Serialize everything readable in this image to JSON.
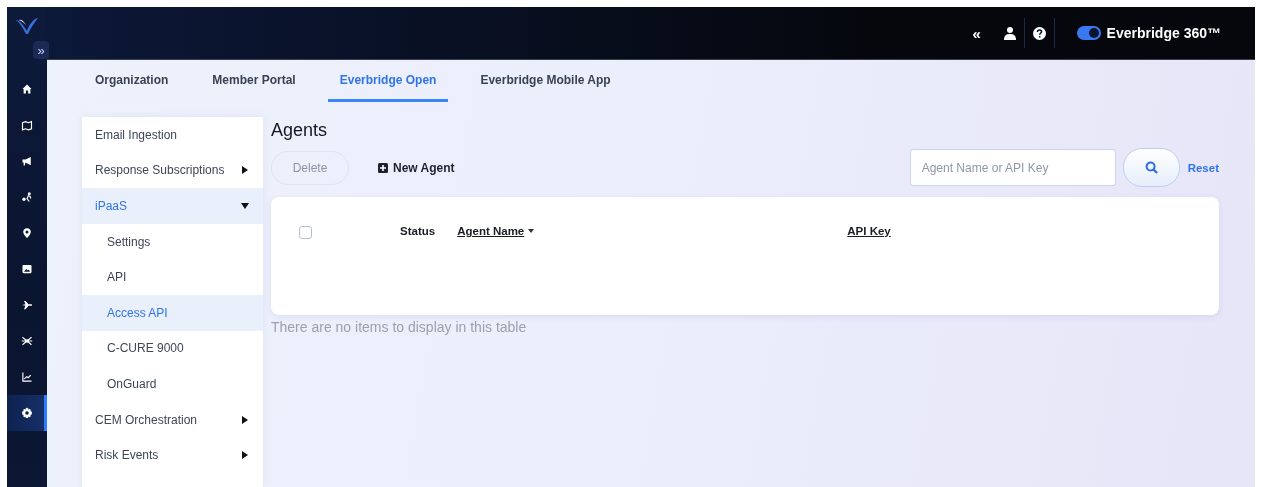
{
  "rail": {
    "expand_label": "»",
    "items": [
      {
        "kind": "home",
        "selected": false
      },
      {
        "kind": "map",
        "selected": false
      },
      {
        "kind": "megaphone",
        "selected": false
      },
      {
        "kind": "people",
        "selected": false
      },
      {
        "kind": "pin",
        "selected": false
      },
      {
        "kind": "image",
        "selected": false
      },
      {
        "kind": "plane",
        "selected": false
      },
      {
        "kind": "network",
        "selected": false
      },
      {
        "kind": "chart",
        "selected": false
      },
      {
        "kind": "gear",
        "selected": true
      }
    ]
  },
  "top_bar": {
    "collapse_label": "«",
    "toggle_on": true,
    "product": "Everbridge 360™"
  },
  "tabs": [
    {
      "label": "Organization",
      "selected": false
    },
    {
      "label": "Member Portal",
      "selected": false
    },
    {
      "label": "Everbridge Open",
      "selected": true
    },
    {
      "label": "Everbridge Mobile App",
      "selected": false
    }
  ],
  "submenu": [
    {
      "label": "Email Ingestion",
      "kind": "link",
      "selected": false
    },
    {
      "label": "Response Subscriptions",
      "kind": "group",
      "expanded": false,
      "selected": false
    },
    {
      "label": "iPaaS",
      "kind": "group",
      "expanded": true,
      "selected": true,
      "children": [
        {
          "label": "Settings",
          "selected": false
        },
        {
          "label": "API",
          "selected": false
        },
        {
          "label": "Access API",
          "selected": true
        },
        {
          "label": "C-CURE 9000",
          "selected": false
        },
        {
          "label": "OnGuard",
          "selected": false
        }
      ]
    },
    {
      "label": "CEM Orchestration",
      "kind": "group",
      "expanded": false,
      "selected": false
    },
    {
      "label": "Risk Events",
      "kind": "group",
      "expanded": false,
      "selected": false
    }
  ],
  "page": {
    "title": "Agents",
    "delete_label": "Delete",
    "delete_disabled": true,
    "new_label": "New Agent",
    "search": {
      "placeholder": "Agent Name or API Key"
    },
    "reset_label": "Reset"
  },
  "table": {
    "select_all_checked": false,
    "columns": [
      {
        "label": "Status",
        "sortable": false,
        "sorted": false
      },
      {
        "label": "Agent Name",
        "sortable": true,
        "sorted": true
      },
      {
        "label": "API Key",
        "sortable": true,
        "sorted": false
      }
    ],
    "empty_message": "There are no items to display in this table"
  }
}
